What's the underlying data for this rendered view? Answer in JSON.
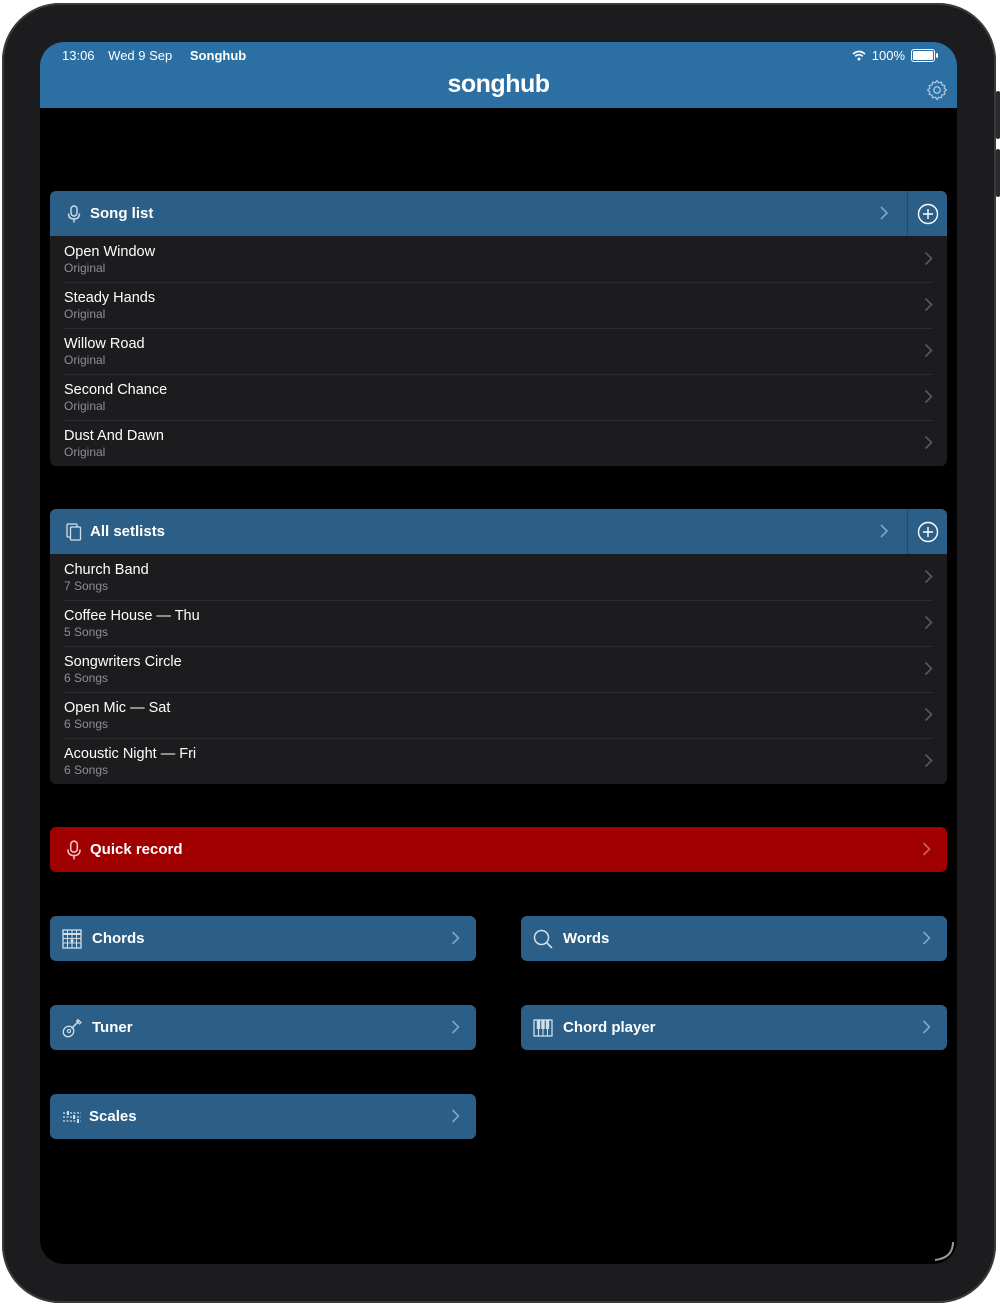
{
  "status_bar": {
    "time": "13:06",
    "date": "Wed 9 Sep",
    "app": "Songhub",
    "battery": "100%"
  },
  "header": {
    "logo": "songhub"
  },
  "song_list": {
    "title": "Song list",
    "items": [
      {
        "name": "Open Window",
        "sub": "Original"
      },
      {
        "name": "Steady Hands",
        "sub": "Original"
      },
      {
        "name": "Willow Road",
        "sub": "Original"
      },
      {
        "name": "Second Chance",
        "sub": "Original"
      },
      {
        "name": "Dust And Dawn",
        "sub": "Original"
      }
    ]
  },
  "setlists": {
    "title": "All setlists",
    "items": [
      {
        "name": "Church Band",
        "sub": "7 Songs"
      },
      {
        "name": "Coffee House — Thu",
        "sub": "5 Songs"
      },
      {
        "name": "Songwriters Circle",
        "sub": "6 Songs"
      },
      {
        "name": "Open Mic — Sat",
        "sub": "6 Songs"
      },
      {
        "name": "Acoustic Night — Fri",
        "sub": "6 Songs"
      }
    ]
  },
  "tools": {
    "quick_record": "Quick record",
    "chords": "Chords",
    "words": "Words",
    "tuner": "Tuner",
    "chord_player": "Chord player",
    "scales": "Scales"
  },
  "colors": {
    "header_blue": "#2b6fa3",
    "section_blue": "#2b5f87",
    "record_red": "#a00000"
  }
}
